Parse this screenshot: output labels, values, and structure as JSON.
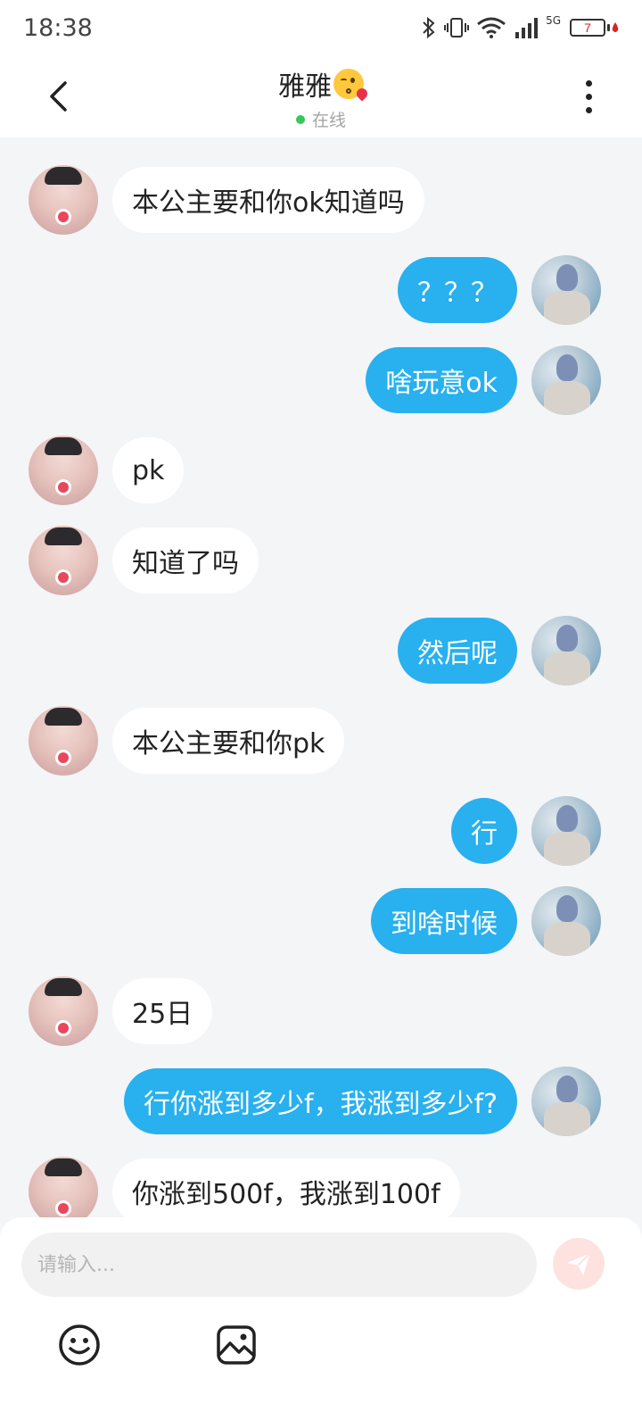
{
  "status_bar": {
    "time": "18:38",
    "network": "5G",
    "battery": "7",
    "icons": [
      "bluetooth-icon",
      "vibrate-icon",
      "wifi-icon",
      "signal-icon",
      "battery-icon"
    ]
  },
  "header": {
    "title": "雅雅",
    "title_emoji": "kissing-face-emoji",
    "status": "在线",
    "status_color": "#35c759"
  },
  "colors": {
    "sent_bubble": "#28b0ef",
    "received_bubble": "#ffffff",
    "background": "#f4f5f7"
  },
  "messages": [
    {
      "side": "left",
      "text": "本公主要和你ok知道吗"
    },
    {
      "side": "right",
      "text": "？？？"
    },
    {
      "side": "right",
      "text": "啥玩意ok"
    },
    {
      "side": "left",
      "text": "pk"
    },
    {
      "side": "left",
      "text": "知道了吗"
    },
    {
      "side": "right",
      "text": "然后呢"
    },
    {
      "side": "left",
      "text": "本公主要和你pk"
    },
    {
      "side": "right",
      "text": "行"
    },
    {
      "side": "right",
      "text": "到啥时候"
    },
    {
      "side": "left",
      "text": "25日"
    },
    {
      "side": "right",
      "text": "行你涨到多少f，我涨到多少f?"
    },
    {
      "side": "left",
      "text": "你涨到500f，我涨到100f"
    }
  ],
  "composer": {
    "placeholder": "请输入...",
    "send_icon": "send-icon",
    "tools": [
      "emoji-icon",
      "image-icon"
    ]
  }
}
